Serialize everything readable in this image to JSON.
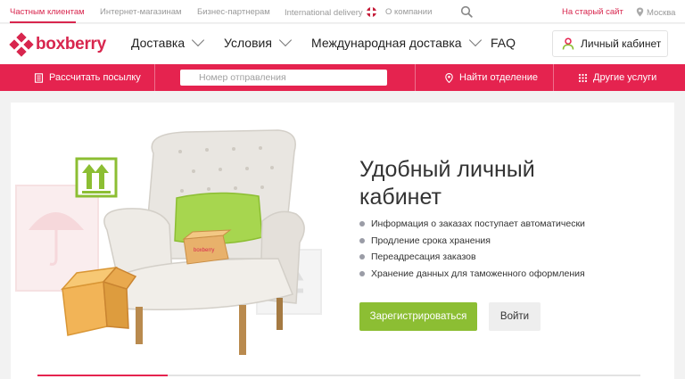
{
  "topbar": {
    "tabs": [
      {
        "label": "Частным клиентам",
        "active": true
      },
      {
        "label": "Интернет-магазинам",
        "active": false
      },
      {
        "label": "Бизнес-партнерам",
        "active": false
      },
      {
        "label": "International delivery",
        "active": false
      },
      {
        "label": "О компании",
        "active": false
      }
    ],
    "old_site": "На старый сайт",
    "city": "Москва"
  },
  "header": {
    "logo": "boxberry",
    "nav": [
      {
        "label": "Доставка",
        "has_dropdown": true
      },
      {
        "label": "Условия",
        "has_dropdown": true
      },
      {
        "label": "Международная доставка",
        "has_dropdown": true
      },
      {
        "label": "FAQ",
        "has_dropdown": false
      }
    ],
    "cabinet": "Личный кабинет"
  },
  "redbar": {
    "calculate": "Рассчитать посылку",
    "track_placeholder": "Номер отправления",
    "find_office": "Найти отделение",
    "other_services": "Другие услуги"
  },
  "hero": {
    "title": "Удобный личный кабинет",
    "features": [
      "Информация о заказах поступает автоматически",
      "Продление срока хранения",
      "Переадресация заказов",
      "Хранение данных для таможенного оформления"
    ],
    "register": "Зарегистрироваться",
    "login": "Войти",
    "box_brand": "boxberry",
    "slides_total": 5,
    "slide_active": 1
  },
  "colors": {
    "brand": "#e5234f",
    "accent_green": "#8cbe33"
  }
}
